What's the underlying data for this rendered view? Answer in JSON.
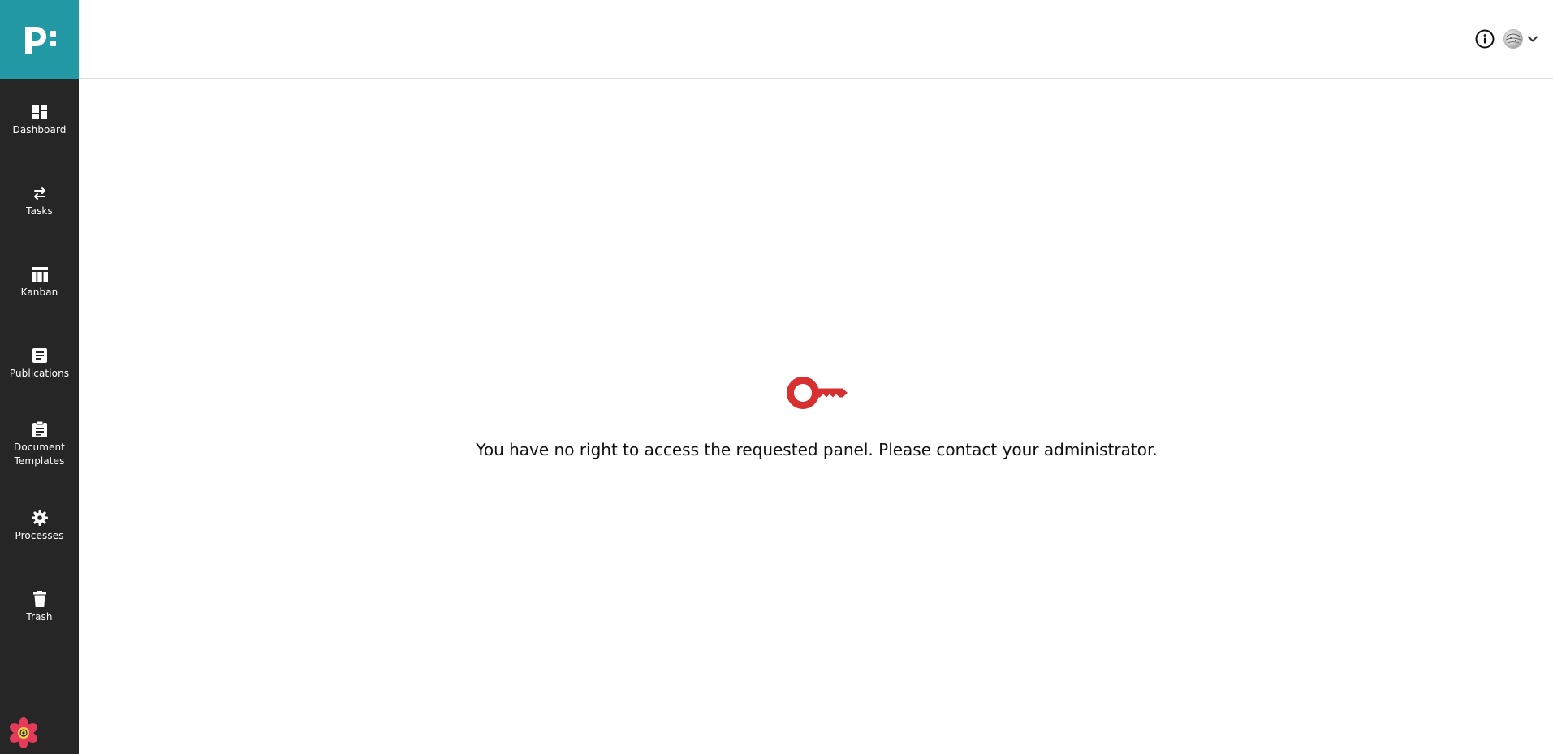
{
  "sidebar": {
    "logo_alt": "p:",
    "items": [
      {
        "label": "Dashboard",
        "icon": "dashboard-icon"
      },
      {
        "label": "Tasks",
        "icon": "swap-arrows-icon"
      },
      {
        "label": "Kanban",
        "icon": "kanban-board-icon"
      },
      {
        "label": "Publications",
        "icon": "article-icon"
      },
      {
        "label": "Document\nTemplates",
        "icon": "clipboard-icon"
      },
      {
        "label": "Processes",
        "icon": "gear-icon"
      },
      {
        "label": "Trash",
        "icon": "trash-icon"
      }
    ],
    "bottom_icon": "flower-icon"
  },
  "topbar": {
    "info_icon": "info-icon",
    "avatar": "avatar",
    "menu_icon": "chevron-down-icon"
  },
  "main": {
    "icon": "key-icon",
    "message": "You have no right to access the requested panel. Please contact your administrator."
  },
  "colors": {
    "brand_teal": "#2399a6",
    "sidebar_bg": "#262626",
    "error_red": "#d63031"
  }
}
